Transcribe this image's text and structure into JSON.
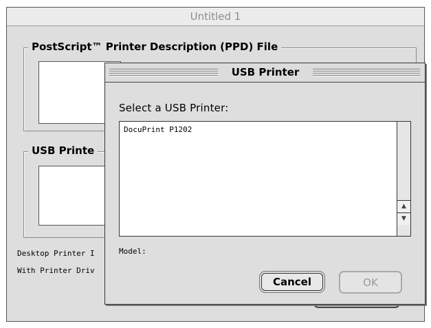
{
  "background_window": {
    "title": "Untitled 1",
    "ppd_group_label": "PostScript™ Printer Description (PPD) File",
    "usb_group_label": "USB Printe",
    "desktop_label": "Desktop Printer I",
    "driver_label": "With Printer Driv"
  },
  "dialog": {
    "title": "USB Printer",
    "select_label": "Select a USB Printer:",
    "printers": [
      "DocuPrint P1202"
    ],
    "model_label": "Model:",
    "cancel_label": "Cancel",
    "ok_label": "OK"
  },
  "icons": {
    "scroll_up": "▲",
    "scroll_down": "▼"
  }
}
